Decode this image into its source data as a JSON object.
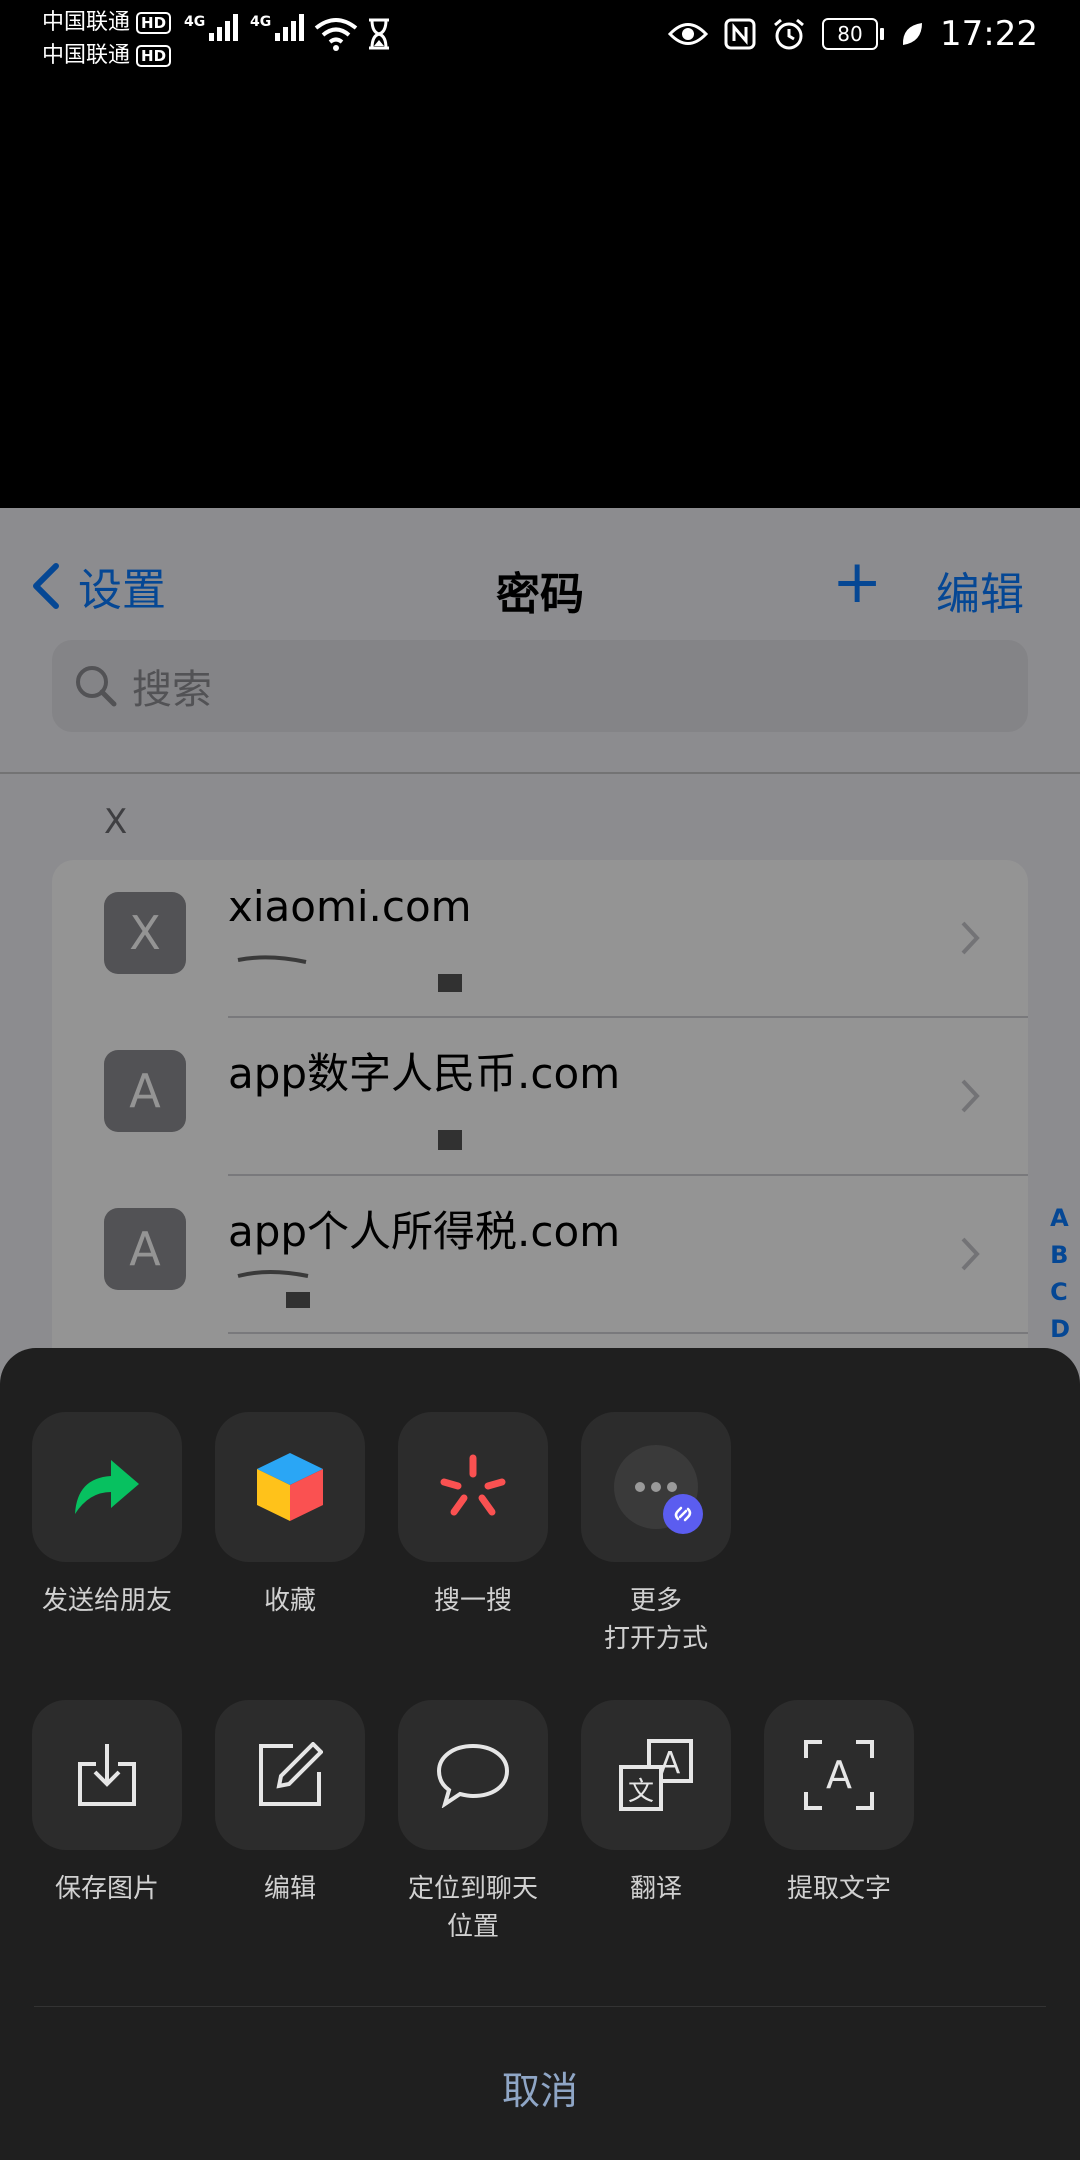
{
  "status_bar": {
    "carrier1": "中国联通",
    "carrier2": "中国联通",
    "hd": "HD",
    "net1": "4G",
    "net2": "4G",
    "battery": "80",
    "time": "17:22"
  },
  "app": {
    "back_label": "设置",
    "title": "密码",
    "plus_label": "+",
    "edit_label": "编辑",
    "search_placeholder": "搜索",
    "section_header": "X",
    "rows": [
      {
        "letter": "X",
        "name": "xiaomi.com"
      },
      {
        "letter": "A",
        "name": "app数字人民币.com"
      },
      {
        "letter": "A",
        "name": "app个人所得税.com"
      }
    ],
    "index_letters": [
      "A",
      "B",
      "C",
      "D"
    ]
  },
  "sheet": {
    "row1": [
      {
        "label": "发送给朋友",
        "icon": "share-arrow-icon"
      },
      {
        "label": "收藏",
        "icon": "cube-icon"
      },
      {
        "label": "搜一搜",
        "icon": "search-spark-icon"
      },
      {
        "label": "更多\n打开方式",
        "icon": "more-icon"
      }
    ],
    "row2": [
      {
        "label": "保存图片",
        "icon": "download-icon"
      },
      {
        "label": "编辑",
        "icon": "edit-icon"
      },
      {
        "label": "定位到聊天\n位置",
        "icon": "chat-bubble-icon"
      },
      {
        "label": "翻译",
        "icon": "translate-icon"
      },
      {
        "label": "提取文字",
        "icon": "text-extract-icon"
      }
    ],
    "cancel": "取消"
  },
  "colors": {
    "accent_blue": "#0a7aff",
    "sheet_bg": "#1f1f1f",
    "tile_bg": "#2c2c2c",
    "wechat_green": "#07c160"
  }
}
